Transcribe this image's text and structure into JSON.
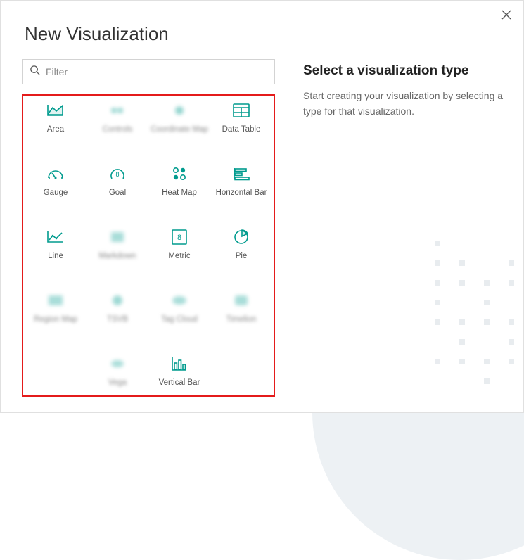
{
  "title": "New Visualization",
  "search": {
    "placeholder": "Filter"
  },
  "right": {
    "heading": "Select a visualization type",
    "text": "Start creating your visualization by selecting a type for that visualization."
  },
  "tiles": [
    {
      "label": "Area",
      "icon": "area",
      "blur": false
    },
    {
      "label": "Controls",
      "icon": "controls",
      "blur": true
    },
    {
      "label": "Coordinate Map",
      "icon": "coordmap",
      "blur": true
    },
    {
      "label": "Data Table",
      "icon": "table",
      "blur": false
    },
    {
      "label": "Gauge",
      "icon": "gauge",
      "blur": false
    },
    {
      "label": "Goal",
      "icon": "goal",
      "blur": false
    },
    {
      "label": "Heat Map",
      "icon": "heatmap",
      "blur": false
    },
    {
      "label": "Horizontal Bar",
      "icon": "hbar",
      "blur": false
    },
    {
      "label": "Line",
      "icon": "line",
      "blur": false
    },
    {
      "label": "Markdown",
      "icon": "markdown",
      "blur": true
    },
    {
      "label": "Metric",
      "icon": "metric",
      "blur": false
    },
    {
      "label": "Pie",
      "icon": "pie",
      "blur": false
    },
    {
      "label": "Region Map",
      "icon": "regionmap",
      "blur": true
    },
    {
      "label": "TSVB",
      "icon": "tsvb",
      "blur": true
    },
    {
      "label": "Tag Cloud",
      "icon": "tagcloud",
      "blur": true
    },
    {
      "label": "Timelion",
      "icon": "timelion",
      "blur": true
    },
    {
      "label": "Vega",
      "icon": "vega",
      "blur": true
    },
    {
      "label": "Vertical Bar",
      "icon": "vbar",
      "blur": false
    }
  ],
  "colors": {
    "accent": "#009b8e"
  }
}
